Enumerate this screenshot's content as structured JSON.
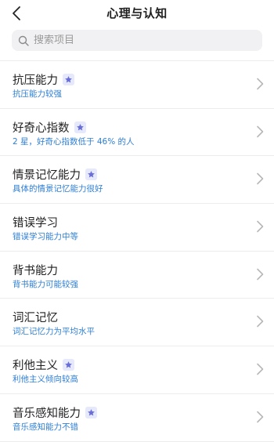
{
  "header": {
    "title": "心理与认知"
  },
  "search": {
    "placeholder": "搜索项目"
  },
  "items": [
    {
      "name": "抗压能力",
      "starred": true,
      "desc": "抗压能力较强"
    },
    {
      "name": "好奇心指数",
      "starred": true,
      "desc": "2 星，好奇心指数低于 46% 的人"
    },
    {
      "name": "情景记忆能力",
      "starred": true,
      "desc": "具体的情景记忆能力很好"
    },
    {
      "name": "错误学习",
      "starred": false,
      "desc": "错误学习能力中等"
    },
    {
      "name": "背书能力",
      "starred": false,
      "desc": "背书能力可能较强"
    },
    {
      "name": "词汇记忆",
      "starred": false,
      "desc": "词汇记忆力为平均水平"
    },
    {
      "name": "利他主义",
      "starred": true,
      "desc": "利他主义倾向较高"
    },
    {
      "name": "音乐感知能力",
      "starred": true,
      "desc": "音乐感知能力不错"
    }
  ],
  "colors": {
    "accent_text": "#2e7fd6",
    "star": "#6a6fd8",
    "star_bg": "#e6e8fb"
  },
  "icons": {
    "back": "chevron-left-icon",
    "search": "search-icon",
    "star": "star-icon",
    "chevron": "chevron-right-icon"
  }
}
